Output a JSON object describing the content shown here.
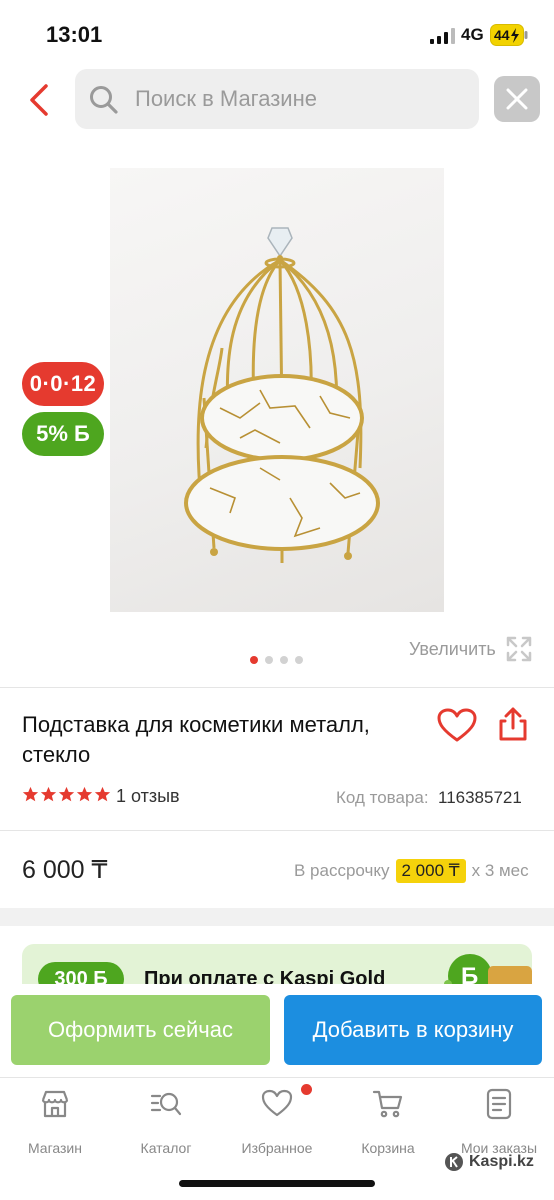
{
  "status_bar": {
    "time": "13:01",
    "network": "4G",
    "battery": "44"
  },
  "header": {
    "search_placeholder": "Поиск в Магазине"
  },
  "gallery": {
    "badge_timer": "0·0·12",
    "badge_bonus": "5% Б",
    "zoom_label": "Увеличить",
    "image_count": 4,
    "active_image": 1
  },
  "product": {
    "title": "Подставка для косметики металл, стекло",
    "rating": 5,
    "reviews": "1 отзыв",
    "sku_label": "Код товара:",
    "sku": "116385721",
    "price": "6 000 ₸",
    "installment_prefix": "В рассрочку",
    "installment_amount": "2 000 ₸",
    "installment_suffix": "x 3 мес"
  },
  "promo": {
    "amount": "300 Б",
    "text": "При оплате с Kaspi Gold"
  },
  "actions": {
    "checkout": "Оформить сейчас",
    "add_to_cart": "Добавить в корзину"
  },
  "tabs": [
    {
      "label": "Магазин",
      "icon": "store-icon"
    },
    {
      "label": "Каталог",
      "icon": "catalog-search-icon"
    },
    {
      "label": "Избранное",
      "icon": "heart-icon"
    },
    {
      "label": "Корзина",
      "icon": "cart-icon"
    },
    {
      "label": "Мои заказы",
      "icon": "orders-icon"
    }
  ],
  "watermark": "Kaspi.kz",
  "colors": {
    "accent_red": "#e53a2f",
    "bonus_green": "#4ea61f",
    "checkout_green": "#9bd26e",
    "cart_blue": "#1c8ee0",
    "installment_yellow": "#f5d20b"
  }
}
